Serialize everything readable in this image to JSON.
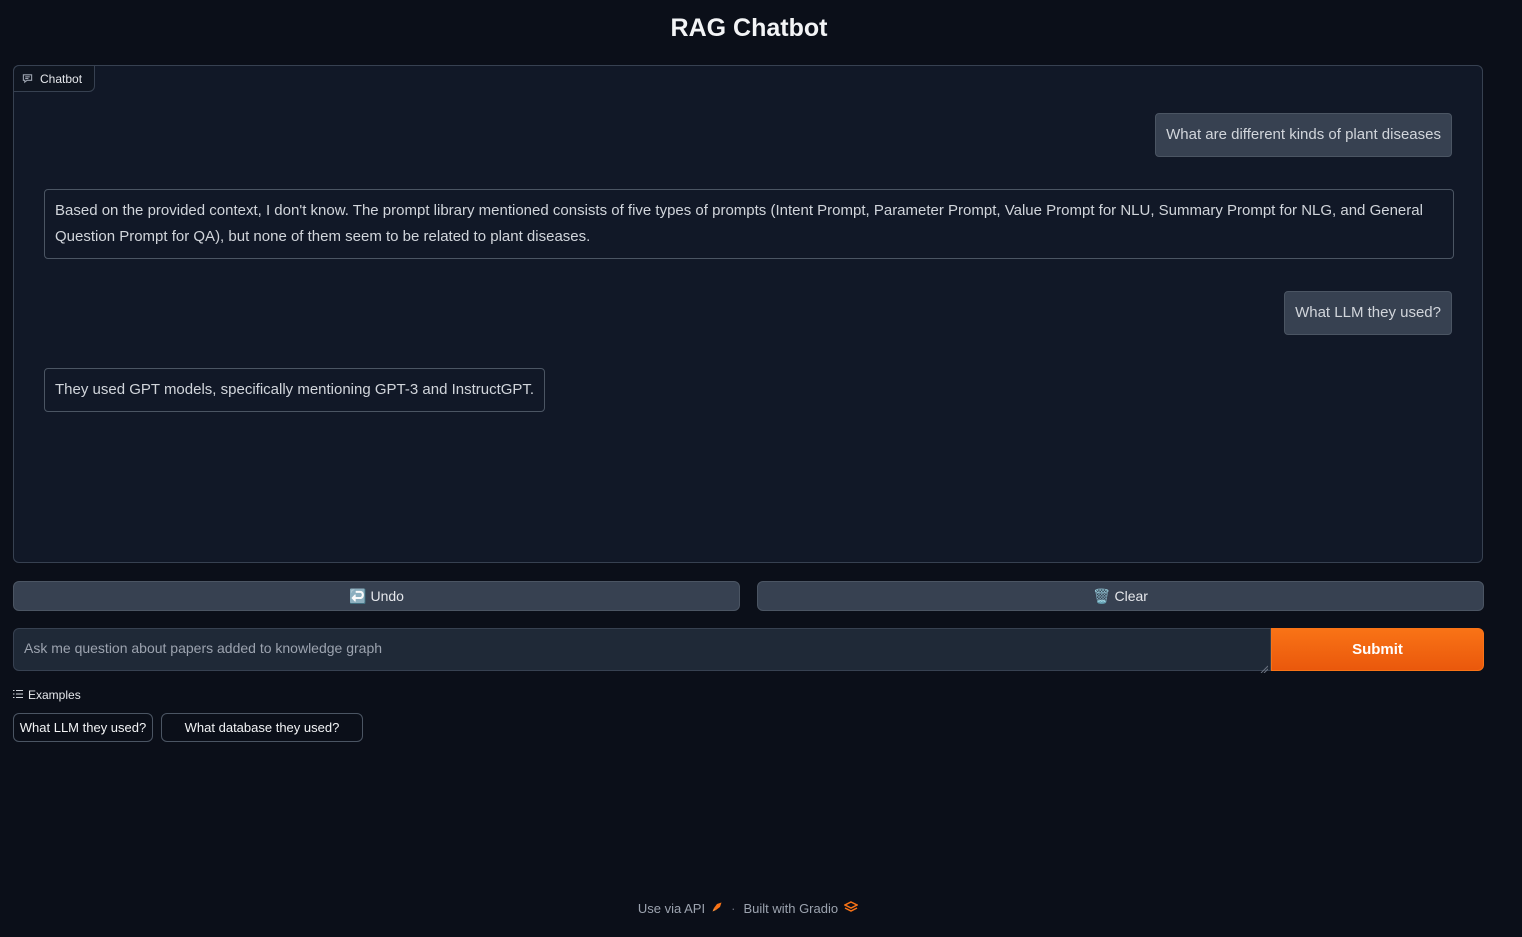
{
  "app": {
    "title": "RAG Chatbot"
  },
  "chatbot": {
    "label": "Chatbot",
    "messages": [
      {
        "role": "user",
        "text": "What are different kinds of plant diseases"
      },
      {
        "role": "bot",
        "text": "Based on the provided context, I don't know. The prompt library mentioned consists of five types of prompts (Intent Prompt, Parameter Prompt, Value Prompt for NLU, Summary Prompt for NLG, and General Question Prompt for QA), but none of them seem to be related to plant diseases."
      },
      {
        "role": "user",
        "text": "What LLM they used?"
      },
      {
        "role": "bot",
        "text": "They used GPT models, specifically mentioning GPT-3 and InstructGPT."
      }
    ]
  },
  "actions": {
    "undo_icon": "↩️",
    "undo_label": "Undo",
    "clear_icon": "🗑️",
    "clear_label": "Clear"
  },
  "input": {
    "placeholder": "Ask me question about papers added to knowledge graph",
    "value": ""
  },
  "submit": {
    "label": "Submit"
  },
  "examples": {
    "label": "Examples",
    "items": [
      "What LLM they used?",
      "What database they used?"
    ]
  },
  "footer": {
    "api_label": "Use via API",
    "separator": "·",
    "built_label": "Built with Gradio"
  },
  "colors": {
    "background": "#0b0f19",
    "panel": "#111827",
    "accent": "#f97316"
  }
}
